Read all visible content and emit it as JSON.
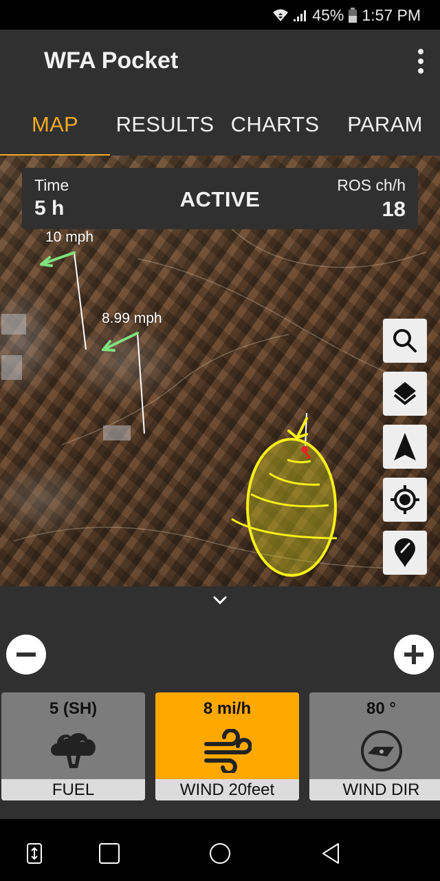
{
  "status_bar": {
    "battery_percent": "45%",
    "time": "1:57 PM",
    "icons": [
      "wifi-icon",
      "signal-icon",
      "battery-icon"
    ]
  },
  "app_bar": {
    "title": "WFA Pocket",
    "overflow_icon": "more-vert-icon"
  },
  "tabs": [
    {
      "label": "MAP",
      "active": true
    },
    {
      "label": "RESULTS",
      "active": false
    },
    {
      "label": "CHARTS",
      "active": false
    },
    {
      "label": "PARAM",
      "active": false
    }
  ],
  "info_panel": {
    "time_label": "Time",
    "time_value": "5 h",
    "status": "ACTIVE",
    "ros_label": "ROS ch/h",
    "ros_value": "18"
  },
  "map": {
    "wind_labels": [
      "10 mph",
      "8.99 mph"
    ],
    "tools": [
      "search-icon",
      "layers-icon",
      "navigation-arrow-icon",
      "my-location-icon",
      "edit-location-icon"
    ],
    "fire_perimeter_color": "#f5ef1a",
    "ignition_point_color": "#e8231f",
    "wind_arrow_color": "#7ee27e"
  },
  "bottom_panel": {
    "collapse_icon": "chevron-down-icon",
    "zoom_out_icon": "minus-icon",
    "zoom_in_icon": "plus-icon",
    "cards": [
      {
        "value": "5 (SH)",
        "label": "FUEL",
        "icon": "tree-icon",
        "active": false
      },
      {
        "value": "8 mi/h",
        "label": "WIND 20feet",
        "icon": "wind-icon",
        "active": true
      },
      {
        "value": "80 °",
        "label": "WIND DIR",
        "icon": "compass-icon",
        "active": false
      }
    ]
  },
  "colors": {
    "accent": "#f4aa22",
    "active_card": "#ffa800",
    "app_bar": "#303030",
    "card": "#7c7c7c"
  },
  "nav_bar": {
    "buttons": [
      "dual-window-icon",
      "recent-apps-icon",
      "home-icon",
      "back-icon"
    ]
  }
}
